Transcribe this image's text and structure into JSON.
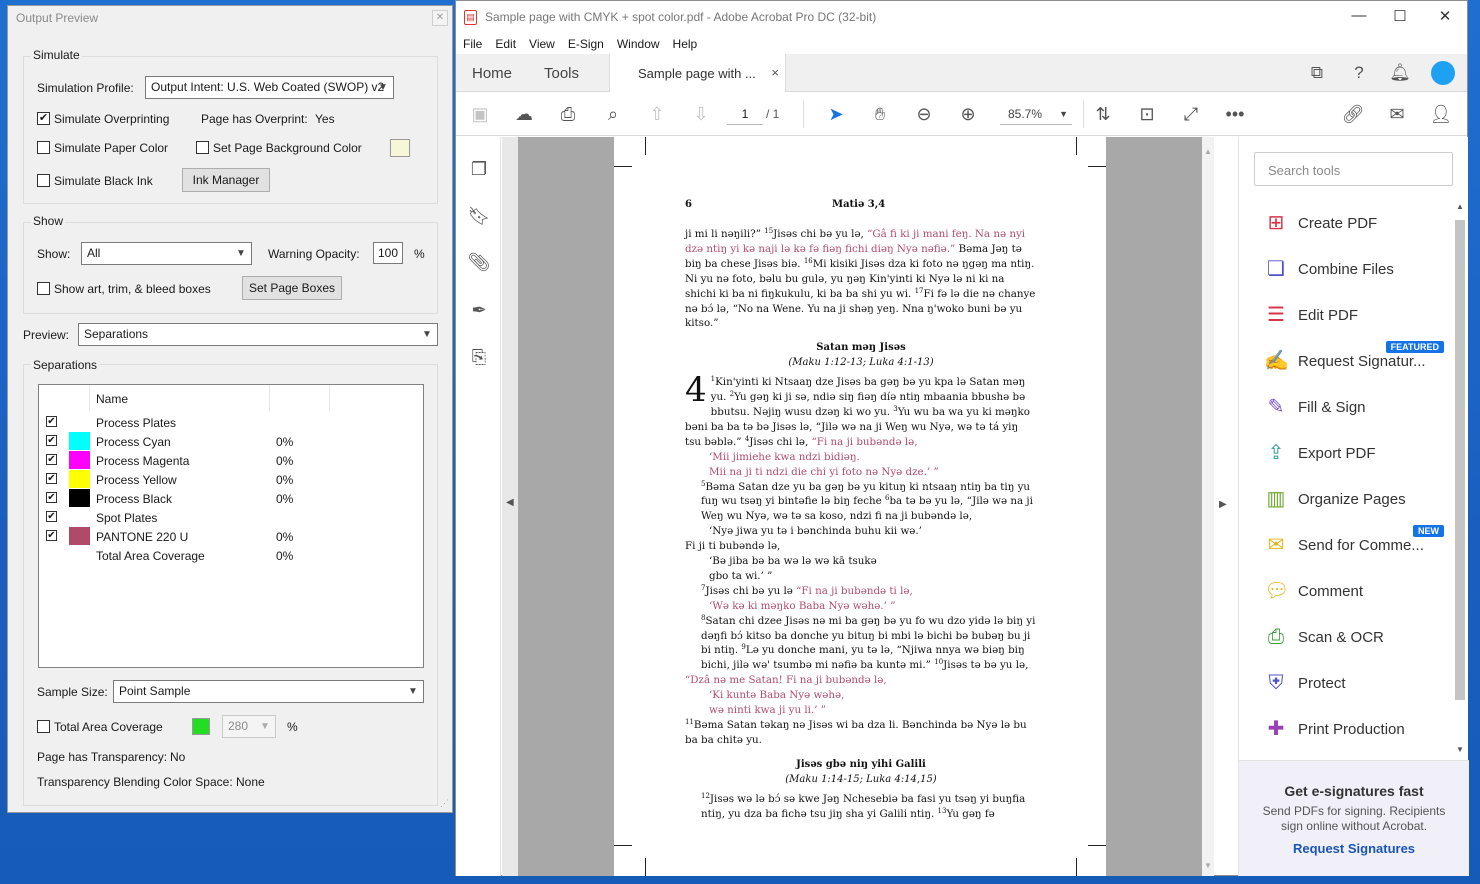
{
  "output_preview": {
    "title": "Output Preview",
    "simulate": {
      "group_label": "Simulate",
      "profile_label": "Simulation Profile:",
      "profile_value": "Output Intent: U.S. Web Coated (SWOP) v2",
      "simulate_overprinting": "Simulate Overprinting",
      "overprint_label": "Page has Overprint:",
      "overprint_value": "Yes",
      "simulate_paper_color": "Simulate Paper Color",
      "set_page_background_color": "Set Page Background Color",
      "simulate_black_ink": "Simulate Black Ink",
      "ink_manager": "Ink Manager"
    },
    "show": {
      "group_label": "Show",
      "show_label": "Show:",
      "show_value": "All",
      "warning_opacity_label": "Warning Opacity:",
      "warning_opacity_value": "100",
      "percent": "%",
      "show_boxes": "Show art, trim, & bleed boxes",
      "set_page_boxes": "Set Page Boxes"
    },
    "preview": {
      "label": "Preview:",
      "value": "Separations"
    },
    "separations": {
      "group_label": "Separations",
      "col_name": "Name",
      "rows": [
        {
          "name": "Process Plates",
          "pct": "",
          "color": "",
          "checked": "✔"
        },
        {
          "name": "Process Cyan",
          "pct": "0%",
          "color": "#00ffff",
          "checked": "✔"
        },
        {
          "name": "Process Magenta",
          "pct": "0%",
          "color": "#ff00ff",
          "checked": "✔"
        },
        {
          "name": "Process Yellow",
          "pct": "0%",
          "color": "#ffff00",
          "checked": "✔"
        },
        {
          "name": "Process Black",
          "pct": "0%",
          "color": "#000000",
          "checked": "✔"
        },
        {
          "name": "Spot Plates",
          "pct": "",
          "color": "",
          "checked": "✔"
        },
        {
          "name": "PANTONE 220 U",
          "pct": "0%",
          "color": "#b04a6a",
          "checked": "✔"
        },
        {
          "name": "Total Area Coverage",
          "pct": "0%",
          "color": "",
          "checked": ""
        }
      ],
      "sample_size_label": "Sample Size:",
      "sample_size_value": "Point Sample",
      "total_area_coverage": "Total Area Coverage",
      "tac_value": "280",
      "tac_percent": "%",
      "transparency_label": "Page has Transparency:",
      "transparency_value": "No",
      "blending_label": "Transparency Blending Color Space:",
      "blending_value": "None"
    }
  },
  "acrobat": {
    "title": "Sample page with CMYK + spot color.pdf - Adobe Acrobat Pro DC (32-bit)",
    "menu": [
      "File",
      "Edit",
      "View",
      "E-Sign",
      "Window",
      "Help"
    ],
    "tabs": {
      "home": "Home",
      "tools": "Tools",
      "doc": "Sample page with ...",
      "close": "×"
    },
    "page_current": "1",
    "page_total": "/ 1",
    "zoom": "85.7%",
    "search_placeholder": "Search tools",
    "tools": [
      {
        "name": "Create PDF",
        "icon": "create-pdf-icon",
        "color": "#d8344a",
        "badge": ""
      },
      {
        "name": "Combine Files",
        "icon": "combine-files-icon",
        "color": "#4f52c9",
        "badge": ""
      },
      {
        "name": "Edit PDF",
        "icon": "edit-pdf-icon",
        "color": "#d8344a",
        "badge": ""
      },
      {
        "name": "Request Signatur...",
        "icon": "request-signature-icon",
        "color": "#9b3fb5",
        "badge": "FEATURED"
      },
      {
        "name": "Fill & Sign",
        "icon": "fill-sign-icon",
        "color": "#7a4fd0",
        "badge": ""
      },
      {
        "name": "Export PDF",
        "icon": "export-pdf-icon",
        "color": "#2d9c8e",
        "badge": ""
      },
      {
        "name": "Organize Pages",
        "icon": "organize-pages-icon",
        "color": "#69a82b",
        "badge": ""
      },
      {
        "name": "Send for Comme...",
        "icon": "send-for-comment-icon",
        "color": "#e3b51a",
        "badge": "NEW"
      },
      {
        "name": "Comment",
        "icon": "comment-icon",
        "color": "#e3b51a",
        "badge": ""
      },
      {
        "name": "Scan & OCR",
        "icon": "scan-ocr-icon",
        "color": "#3a9b3a",
        "badge": ""
      },
      {
        "name": "Protect",
        "icon": "protect-icon",
        "color": "#4f52c9",
        "badge": ""
      },
      {
        "name": "Print Production",
        "icon": "print-production-icon",
        "color": "#9b3fb5",
        "badge": ""
      }
    ],
    "esign": {
      "heading": "Get e-signatures fast",
      "body": "Send PDFs for signing. Recipients sign online without Acrobat.",
      "link": "Request Signatures"
    },
    "doc_page": {
      "page_number": "6",
      "running_head": "Matiə 3,4",
      "p1_a": "ji mi li nəŋili?” ",
      "v15": "15",
      "p1_b": "Jisəs chi bə yu lə, ",
      "p1_red": "“Gâ fi ki ji mani feŋ. Na nə nyi dzə ntiŋ yi kə naji lə kə fə fiəŋ fichi diəŋ Nyə nəfiə.”",
      "p1_c": " Bəma Jəŋ tə biŋ ba chese Jisəs biə. ",
      "v16": "16",
      "p1_d": "Mi kisiki Jisəs dza ki foto nə ŋgəŋ ma ntiŋ. Ni yu nə foto, bəlu bu gulə, yu ŋəŋ Kin'yinti ki Nyə lə ni ki na shichi ki ba ni fiŋkukulu, ki ba ba shi yu wi. ",
      "v17": "17",
      "p1_e": "Fi fə lə die nə chanye nə bɔ́ lə, “No na Wene. Yu na ji shəŋ yeŋ. Nna ŋ'woko buni bə yu kitso.”",
      "h1": "Satan məŋ Jisəs",
      "h1_ref": "(Maku 1:12-13; Luka 4:1-13)",
      "chapter": "4",
      "v1": "1",
      "p2_a": "Kin'yinti ki Ntsaaŋ dze Jisəs ba gəŋ bə yu kpa lə Satan məŋ yu. ",
      "v2": "2",
      "p2_b": "Yu gəŋ ki ji sə, ndiə siŋ fiəŋ díə ntiŋ mbaania bbushə bə bbutsu. Nəjiŋ wusu dzəŋ ki wo yu. ",
      "v3": "3",
      "p2_c": "Yu wu ba wa yu ki məŋko bəni ba ba tə bə Jisəs lə, “Jilə wə na ji Weŋ wu Nyə, wə tə tá yiŋ tsu bəblə.” ",
      "v4": "4",
      "p2_d": "Jisəs chi lə, ",
      "p2_red": "“Fi na ji bubəndə lə,",
      "q1": "‘Mii jimiehe kwa ndzi bidiəŋ.",
      "q2": "Mii na ji ti ndzi die chi yi foto nə Nyə dze.’ ”",
      "v5": "5",
      "p3_a": "Bəma Satan dze yu ba gəŋ bə yu kituŋ ki ntsaaŋ ntiŋ ba tiŋ yu fuŋ wu tsəŋ yi bintəfie lə biŋ feche ",
      "v6": "6",
      "p3_b": "ba tə bə yu lə, “Jilə wə na ji Weŋ wu Nyə, wə tə sa koso, ndzi fi na ji bubəndə lə,",
      "q3": "‘Nyə jiwa yu tə i bənchinda buhu kii wə.’",
      "p3_c": "Fi ji ti bubəndə lə,",
      "q4": "‘Bə jiba bə ba wə lə wə kā tsukə",
      "q5": "gbo ta wi.’ ”",
      "v7": "7",
      "p4_a": "Jisəs chi bə yu lə ",
      "p4_red": "“Fi na ji bubəndə ti lə,",
      "q6": "‘Wə kə ki məŋko Baba Nyə wəhə.’ ”",
      "v8": "8",
      "p5_a": "Satan chi dzee Jisəs nə mi ba gəŋ bə yu fo wu dzo yidə lə biŋ yi dəŋfi bɔ́ kitso ba donche yu bituŋ bi mbi lə bichi bə bubəŋ bu ji bi ntiŋ. ",
      "v9": "9",
      "p5_b": "Lə yu donche mani, yu tə lə, “Njiwa nnya wə biəŋ biŋ bichi, jilə wə' tsumbə mi nəfiə ba kuntə mi.” ",
      "v10": "10",
      "p5_c": "Jisəs tə bə yu lə,",
      "p5_red": "“Dzâ nə me Satan! Fi na ji bubəndə lə,",
      "q7": "‘Ki kuntə Baba Nyə wəhə,",
      "q8": "wə ninti kwa ji yu li.’ ”",
      "v11": "11",
      "p6": "Bəma Satan təkaŋ nə Jisəs wi ba dza li. Bənchinda bə Nyə lə bu ba ba chitə yu.",
      "h2": "Jisəs gbə niŋ yihi Galili",
      "h2_ref": "(Maku 1:14-15; Luka 4:14,15)",
      "v12": "12",
      "p7_a": "Jisəs wə lə bɔ́ sə kwe Jəŋ Nchesebiə ba fasi yu tsəŋ yi buŋfia ntiŋ, yu dza ba fichə tsu jiŋ sha yi Galili ntiŋ. ",
      "v13": "13",
      "p7_b": "Yu gəŋ fə"
    }
  }
}
